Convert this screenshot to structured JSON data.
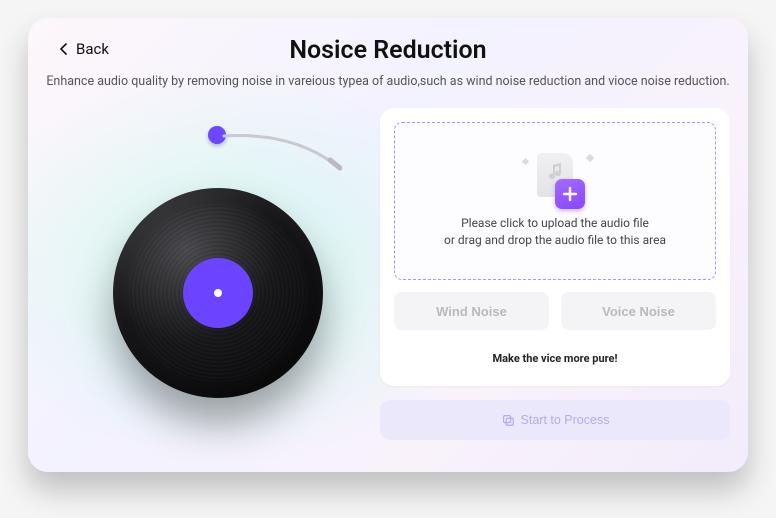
{
  "nav": {
    "back_label": "Back"
  },
  "header": {
    "title": "Nosice Reduction",
    "subtitle": "Enhance audio quality by removing noise in vareious typea of audio,such as wind noise reduction and vioce noise reduction."
  },
  "dropzone": {
    "line1": "Please click to upload the audio file",
    "line2": "or drag and drop the audio file to this area"
  },
  "noise_options": {
    "wind_label": "Wind Noise",
    "voice_label": "Voice Noise"
  },
  "caption": "Make the vice more pure!",
  "process_button_label": "Start to Process",
  "colors": {
    "accent": "#6c47ff",
    "badge": "#8a46ff",
    "dashed": "#a892ff"
  }
}
